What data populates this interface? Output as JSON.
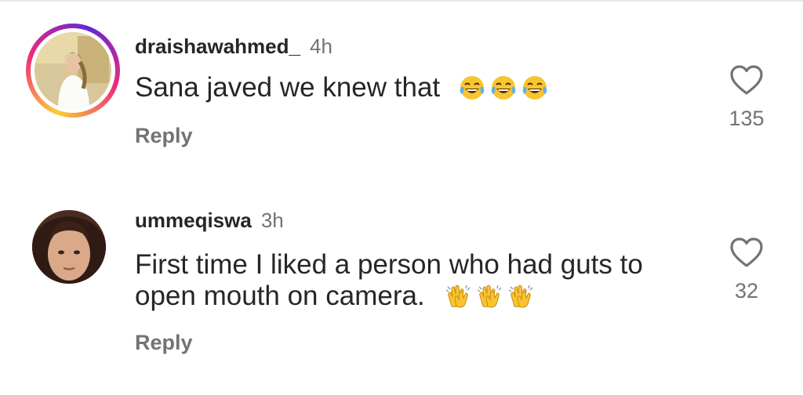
{
  "comments": [
    {
      "username": "draishawahmed_",
      "time": "4h",
      "text": "Sana javed we knew that",
      "emojis": [
        "tears-of-joy",
        "tears-of-joy",
        "tears-of-joy"
      ],
      "reply_label": "Reply",
      "likes": "135",
      "has_story_ring": true
    },
    {
      "username": "ummeqiswa",
      "time": "3h",
      "text_line1": "First time I liked a person who had guts to",
      "text_line2": "open mouth on camera.",
      "emojis": [
        "clapping-hands",
        "clapping-hands",
        "clapping-hands"
      ],
      "reply_label": "Reply",
      "likes": "32",
      "has_story_ring": false
    }
  ],
  "colors": {
    "primary_text": "#262626",
    "secondary_text": "#737373",
    "emoji_yellow": "#f8c530"
  }
}
